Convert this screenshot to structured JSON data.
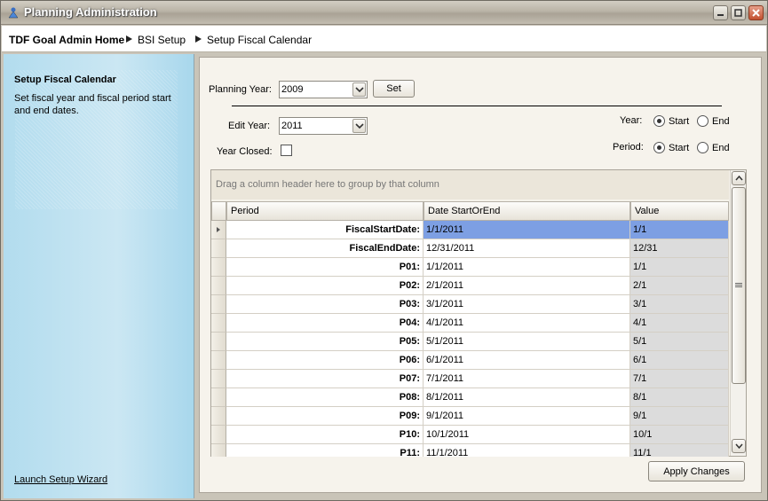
{
  "window": {
    "title": "Planning Administration",
    "icon": "app-icon"
  },
  "breadcrumb": {
    "items": [
      "TDF Goal Admin Home",
      "BSI Setup",
      "Setup Fiscal Calendar"
    ]
  },
  "sidebar": {
    "title": "Setup Fiscal Calendar",
    "description": "Set fiscal year and fiscal period start and end dates.",
    "link": "Launch Setup Wizard"
  },
  "form": {
    "planning_year_label": "Planning Year:",
    "planning_year_value": "2009",
    "set_label": "Set",
    "edit_year_label": "Edit Year:",
    "edit_year_value": "2011",
    "year_closed_label": "Year Closed:",
    "year_closed_checked": false,
    "year_label": "Year:",
    "period_label": "Period:",
    "start_label": "Start",
    "end_label": "End",
    "year_selected": "Start",
    "period_selected": "Start"
  },
  "grid": {
    "group_hint": "Drag a column header here to group by that column",
    "columns": [
      "Period",
      "Date StartOrEnd",
      "Value"
    ],
    "rows": [
      {
        "period": "FiscalStartDate:",
        "date": "1/1/2011",
        "value": "1/1"
      },
      {
        "period": "FiscalEndDate:",
        "date": "12/31/2011",
        "value": "12/31"
      },
      {
        "period": "P01:",
        "date": "1/1/2011",
        "value": "1/1"
      },
      {
        "period": "P02:",
        "date": "2/1/2011",
        "value": "2/1"
      },
      {
        "period": "P03:",
        "date": "3/1/2011",
        "value": "3/1"
      },
      {
        "period": "P04:",
        "date": "4/1/2011",
        "value": "4/1"
      },
      {
        "period": "P05:",
        "date": "5/1/2011",
        "value": "5/1"
      },
      {
        "period": "P06:",
        "date": "6/1/2011",
        "value": "6/1"
      },
      {
        "period": "P07:",
        "date": "7/1/2011",
        "value": "7/1"
      },
      {
        "period": "P08:",
        "date": "8/1/2011",
        "value": "8/1"
      },
      {
        "period": "P09:",
        "date": "9/1/2011",
        "value": "9/1"
      },
      {
        "period": "P10:",
        "date": "10/1/2011",
        "value": "10/1"
      },
      {
        "period": "P11:",
        "date": "11/1/2011",
        "value": "11/1"
      }
    ],
    "selected_row": 0
  },
  "apply_label": "Apply Changes",
  "colors": {
    "selection": "#7d9fe3",
    "sidebar": "#b2dcee"
  }
}
